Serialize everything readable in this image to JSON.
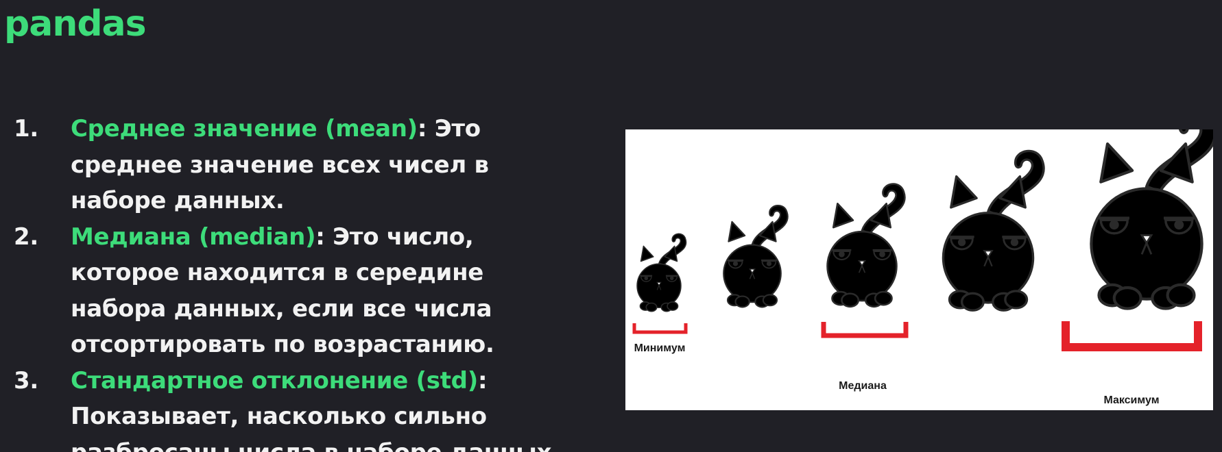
{
  "title": "pandas",
  "items": [
    {
      "number": "1.",
      "term": "Среднее значение (mean)",
      "separator": ":",
      "description_lines": [
        " Это",
        "среднее значение всех чисел в",
        "наборе данных."
      ]
    },
    {
      "number": "2.",
      "term": "Медиана (median)",
      "separator": ":",
      "description_lines": [
        " Это число,",
        "которое находится в середине",
        "набора данных, если все числа",
        "отсортировать по возрастанию."
      ]
    },
    {
      "number": "3.",
      "term": "Стандартное отклонение (std)",
      "separator": ":",
      "description_lines": [
        "",
        "Показывает, насколько сильно",
        "разбросаны числа в наборе данных."
      ]
    }
  ],
  "figure": {
    "labels": {
      "minimum": "Минимум",
      "median": "Медиана",
      "maximum": "Максимум"
    },
    "colors": {
      "bracket": "#e4222a",
      "cat_dark": "#616163",
      "cat_light": "#e4e4e4",
      "eyes_yellow": "#f0d21a",
      "eyes_blue": "#55a8dc"
    }
  },
  "colors": {
    "background": "#202026",
    "accent": "#3ddc7a",
    "text": "#f2f2f2"
  }
}
